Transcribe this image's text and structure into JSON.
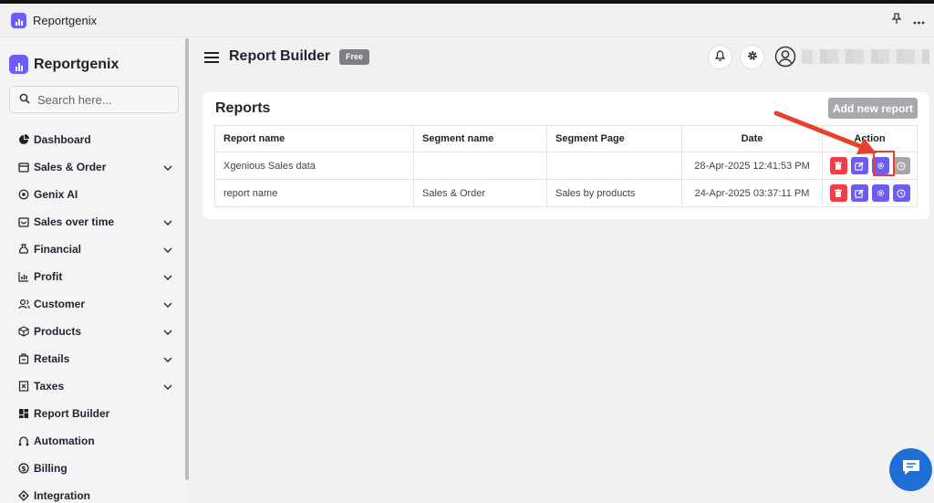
{
  "app": {
    "title": "Reportgenix",
    "brand": "Reportgenix"
  },
  "search": {
    "placeholder": "Search here..."
  },
  "sidebar": {
    "items": [
      {
        "label": "Dashboard",
        "icon": "pie-chart-icon",
        "expandable": false
      },
      {
        "label": "Sales & Order",
        "icon": "box-icon",
        "expandable": true
      },
      {
        "label": "Genix AI",
        "icon": "ai-icon",
        "expandable": false
      },
      {
        "label": "Sales over time",
        "icon": "inbox-icon",
        "expandable": true
      },
      {
        "label": "Financial",
        "icon": "money-bag-icon",
        "expandable": true
      },
      {
        "label": "Profit",
        "icon": "bar-chart-icon",
        "expandable": true
      },
      {
        "label": "Customer",
        "icon": "users-icon",
        "expandable": true
      },
      {
        "label": "Products",
        "icon": "cube-icon",
        "expandable": true
      },
      {
        "label": "Retails",
        "icon": "store-icon",
        "expandable": true
      },
      {
        "label": "Taxes",
        "icon": "tax-icon",
        "expandable": true
      },
      {
        "label": "Report Builder",
        "icon": "grid-icon",
        "expandable": false
      },
      {
        "label": "Automation",
        "icon": "automation-icon",
        "expandable": false
      },
      {
        "label": "Billing",
        "icon": "dollar-icon",
        "expandable": false
      },
      {
        "label": "Integration",
        "icon": "integration-icon",
        "expandable": false
      }
    ]
  },
  "header": {
    "title": "Report Builder",
    "badge": "Free"
  },
  "reports": {
    "title": "Reports",
    "add_button": "Add new report",
    "columns": [
      "Report name",
      "Segment name",
      "Segment Page",
      "Date",
      "Action"
    ],
    "rows": [
      {
        "report_name": "Xgenious Sales data",
        "segment_name": "",
        "segment_page": "",
        "date": "28-Apr-2025 12:41:53 PM"
      },
      {
        "report_name": "report name",
        "segment_name": "Sales & Order",
        "segment_page": "Sales by products",
        "date": "24-Apr-2025 03:37:11 PM"
      }
    ]
  },
  "colors": {
    "accent": "#6c5cf0",
    "danger": "#ef3d49",
    "annotation": "#e8402a",
    "chat": "#1e6ed6"
  }
}
